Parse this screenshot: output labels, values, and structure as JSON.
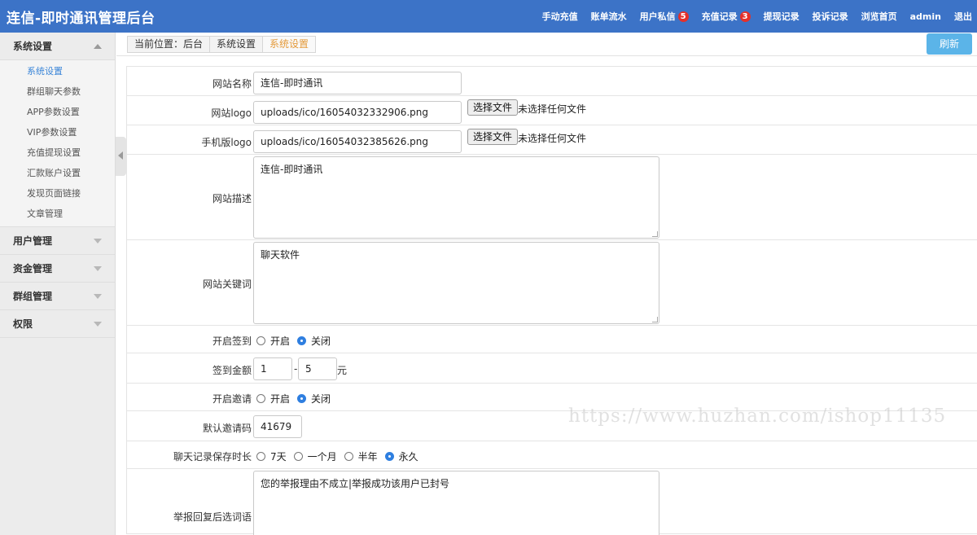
{
  "header": {
    "title": "连信-即时通讯管理后台",
    "nav": [
      {
        "label": "手动充值"
      },
      {
        "label": "账单流水"
      },
      {
        "label": "用户私信",
        "badge": "5"
      },
      {
        "label": "充值记录",
        "badge": "3"
      },
      {
        "label": "提现记录"
      },
      {
        "label": "投诉记录"
      },
      {
        "label": "浏览首页"
      },
      {
        "label": "admin"
      },
      {
        "label": "退出"
      }
    ]
  },
  "sidebar": {
    "sections": [
      {
        "label": "系统设置",
        "expanded": true,
        "items": [
          "系统设置",
          "群组聊天参数",
          "APP参数设置",
          "VIP参数设置",
          "充值提现设置",
          "汇款账户设置",
          "发现页面链接",
          "文章管理"
        ],
        "active": "系统设置"
      },
      {
        "label": "用户管理",
        "expanded": false
      },
      {
        "label": "资金管理",
        "expanded": false
      },
      {
        "label": "群组管理",
        "expanded": false
      },
      {
        "label": "权限",
        "expanded": false
      }
    ]
  },
  "breadcrumb": {
    "prefix": "当前位置：后台",
    "level1": "系统设置",
    "current": "系统设置"
  },
  "refresh_label": "刷新",
  "form": {
    "site_name": {
      "label": "网站名称",
      "value": "连信-即时通讯"
    },
    "site_logo": {
      "label": "网站logo",
      "value": "uploads/ico/16054032332906.png",
      "button": "选择文件",
      "status": "未选择任何文件"
    },
    "mobile_logo": {
      "label": "手机版logo",
      "value": "uploads/ico/16054032385626.png",
      "button": "选择文件",
      "status": "未选择任何文件"
    },
    "site_desc": {
      "label": "网站描述",
      "value": "连信-即时通讯"
    },
    "site_keywords": {
      "label": "网站关键词",
      "value": "聊天软件"
    },
    "checkin": {
      "label": "开启签到",
      "options": [
        "开启",
        "关闭"
      ],
      "selected": "关闭"
    },
    "checkin_amount": {
      "label": "签到金额",
      "min": "1",
      "separator": "-",
      "max": "5",
      "unit": "元"
    },
    "invite": {
      "label": "开启邀请",
      "options": [
        "开启",
        "关闭"
      ],
      "selected": "关闭"
    },
    "default_invite_code": {
      "label": "默认邀请码",
      "value": "41679"
    },
    "chat_retention": {
      "label": "聊天记录保存时长",
      "options": [
        "7天",
        "一个月",
        "半年",
        "永久"
      ],
      "selected": "永久"
    },
    "report_reply": {
      "label": "举报回复后选词语",
      "value": "您的举报理由不成立|举报成功该用户已封号"
    }
  },
  "watermark": "https://www.huzhan.com/ishop11135"
}
